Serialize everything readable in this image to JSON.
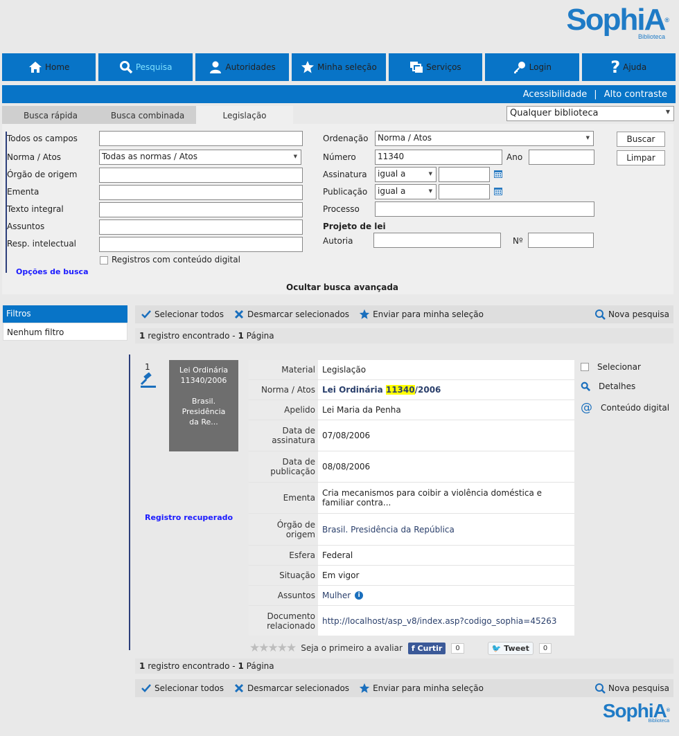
{
  "logo": {
    "word": "SophiA",
    "reg": "®",
    "sub": "Biblioteca"
  },
  "nav": [
    {
      "label": "Home",
      "icon": "home-icon"
    },
    {
      "label": "Pesquisa",
      "icon": "search-icon",
      "active": true
    },
    {
      "label": "Autoridades",
      "icon": "user-icon"
    },
    {
      "label": "Minha seleção",
      "icon": "star-icon"
    },
    {
      "label": "Serviços",
      "icon": "windows-icon"
    },
    {
      "label": "Login",
      "icon": "key-icon"
    },
    {
      "label": "Ajuda",
      "icon": "help-icon"
    }
  ],
  "accessibility": {
    "acess": "Acessibilidade",
    "sep": "|",
    "contrast": "Alto contraste"
  },
  "tabs": [
    "Busca rápida",
    "Busca combinada",
    "Legislação"
  ],
  "library_select": "Qualquer biblioteca",
  "form": {
    "todos": "Todos os campos",
    "norma": "Norma / Atos",
    "norma_value": "Todas as normas / Atos",
    "orgao": "Órgão de origem",
    "ementa": "Ementa",
    "texto": "Texto integral",
    "assuntos": "Assuntos",
    "resp": "Resp. intelectual",
    "digital": "Registros com conteúdo digital",
    "opcoes": "Opções de busca",
    "ordenacao": "Ordenação",
    "ordenacao_value": "Norma / Atos",
    "numero": "Número",
    "numero_value": "11340",
    "ano": "Ano",
    "assinatura": "Assinatura",
    "assinatura_op": "igual a",
    "publicacao": "Publicação",
    "publicacao_op": "igual a",
    "processo": "Processo",
    "projeto": "Projeto de lei",
    "autoria": "Autoria",
    "no": "Nº",
    "buscar": "Buscar",
    "limpar": "Limpar",
    "ocultar": "Ocultar busca avançada"
  },
  "filters": {
    "title": "Filtros",
    "none": "Nenhum filtro"
  },
  "toolbar": {
    "select_all": "Selecionar todos",
    "deselect": "Desmarcar selecionados",
    "send": "Enviar para minha seleção",
    "new_search": "Nova pesquisa"
  },
  "count": {
    "n": "1",
    "found": "registro encontrado",
    "dash": "-",
    "pages": "1",
    "page_lbl": "Página"
  },
  "record": {
    "index": "1",
    "thumb_line1": "Lei Ordinária",
    "thumb_line2": "11340/2006",
    "thumb_line3": "Brasil. Presidência",
    "thumb_line4": "da Re...",
    "status": "Registro recuperado",
    "fields": [
      {
        "k": "Material",
        "v": "Legislação"
      },
      {
        "k": "Norma / Atos",
        "v_pre": "Lei Ordinária ",
        "v_hl": "11340",
        "v_post": "/2006"
      },
      {
        "k": "Apelido",
        "v": "Lei Maria da Penha"
      },
      {
        "k": "Data de assinatura",
        "v": "07/08/2006"
      },
      {
        "k": "Data de publicação",
        "v": "08/08/2006"
      },
      {
        "k": "Ementa",
        "v": "Cria mecanismos para coibir a violência doméstica e familiar contra..."
      },
      {
        "k": "Órgão de origem",
        "v": "Brasil. Presidência da República"
      },
      {
        "k": "Esfera",
        "v": "Federal"
      },
      {
        "k": "Situação",
        "v": "Em vigor"
      },
      {
        "k": "Assuntos",
        "v": "Mulher"
      },
      {
        "k": "Documento relacionado",
        "v": "http://localhost/asp_v8/index.asp?codigo_sophia=45263"
      }
    ],
    "actions": {
      "select": "Selecionar",
      "details": "Detalhes",
      "digital": "Conteúdo digital"
    },
    "rating": {
      "text": "Seja o primeiro a avaliar",
      "fb": "Curtir",
      "fb_count": "0",
      "tw": "Tweet",
      "tw_count": "0"
    }
  }
}
